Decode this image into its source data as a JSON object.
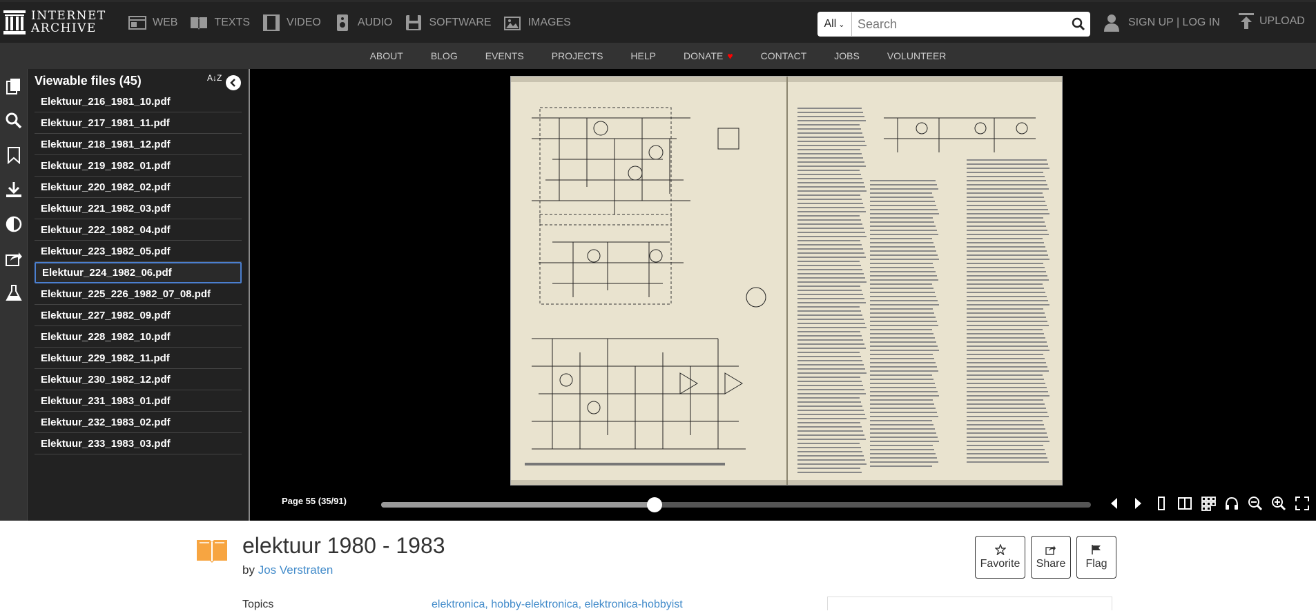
{
  "header": {
    "logo_line1": "INTERNET",
    "logo_line2": "ARCHIVE",
    "media_types": [
      {
        "label": "WEB",
        "icon": "web-icon"
      },
      {
        "label": "TEXTS",
        "icon": "texts-icon"
      },
      {
        "label": "VIDEO",
        "icon": "video-icon"
      },
      {
        "label": "AUDIO",
        "icon": "audio-icon"
      },
      {
        "label": "SOFTWARE",
        "icon": "software-icon"
      },
      {
        "label": "IMAGES",
        "icon": "images-icon"
      }
    ],
    "search": {
      "scope": "All",
      "placeholder": "Search",
      "value": ""
    },
    "signup": "SIGN UP | LOG IN",
    "upload": "UPLOAD"
  },
  "subnav": {
    "items": [
      "ABOUT",
      "BLOG",
      "EVENTS",
      "PROJECTS",
      "HELP",
      "DONATE",
      "CONTACT",
      "JOBS",
      "VOLUNTEER"
    ],
    "donate_heart": "♥",
    "donate_color": "#ff0100"
  },
  "sidepanel": {
    "title": "Viewable files (45)",
    "sort_label": "A↓Z",
    "files": [
      "Elektuur_216_1981_10.pdf",
      "Elektuur_217_1981_11.pdf",
      "Elektuur_218_1981_12.pdf",
      "Elektuur_219_1982_01.pdf",
      "Elektuur_220_1982_02.pdf",
      "Elektuur_221_1982_03.pdf",
      "Elektuur_222_1982_04.pdf",
      "Elektuur_223_1982_05.pdf",
      "Elektuur_224_1982_06.pdf",
      "Elektuur_225_226_1982_07_08.pdf",
      "Elektuur_227_1982_09.pdf",
      "Elektuur_228_1982_10.pdf",
      "Elektuur_229_1982_11.pdf",
      "Elektuur_230_1982_12.pdf",
      "Elektuur_231_1983_01.pdf",
      "Elektuur_232_1983_02.pdf",
      "Elektuur_233_1983_03.pdf"
    ],
    "selected_index": 8,
    "selected_color": "#4b7fcf"
  },
  "viewer": {
    "page_label": "Page 55 (35/91)",
    "progress": 0.385,
    "controls": [
      "prev-page-icon",
      "next-page-icon",
      "one-page-view-icon",
      "two-page-view-icon",
      "thumbnail-view-icon",
      "read-aloud-icon",
      "zoom-out-icon",
      "zoom-in-icon",
      "fullscreen-icon"
    ]
  },
  "item": {
    "title": "elektuur 1980 - 1983",
    "by_prefix": "by",
    "author": "Jos Verstraten",
    "actions": [
      "Favorite",
      "Share",
      "Flag"
    ],
    "topics_label": "Topics",
    "topics_value": "elektronica, hobby-elektronica, elektronica-hobbyist",
    "link_color": "#428bca",
    "book_icon_color": "#f7a541"
  }
}
